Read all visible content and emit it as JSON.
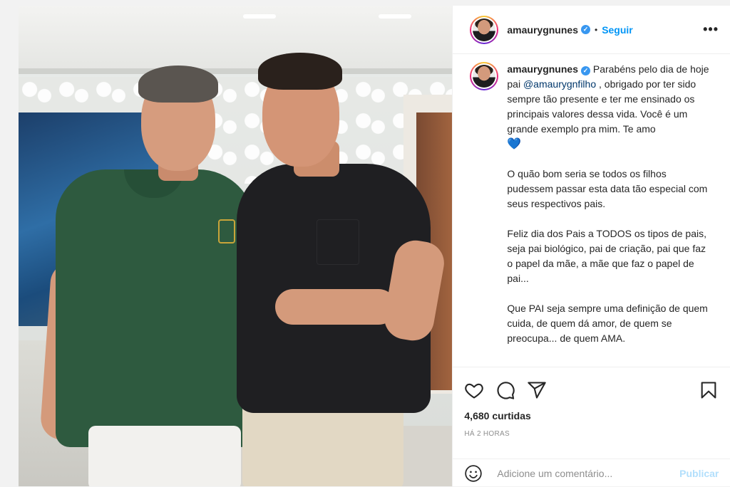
{
  "header": {
    "username": "amaurygnunes",
    "follow_label": "Seguir",
    "separator": "•",
    "more_label": "•••"
  },
  "caption": {
    "username": "amaurygnunes",
    "intro": " Parabéns pelo dia de hoje pai ",
    "mention": "@amaurygnfilho",
    "rest": " , obrigado por ter sido sempre tão presente e ter me ensinado os principais valores dessa vida. Você é um grande exemplo pra mim. Te amo",
    "heart": "💙",
    "paragraphs": [
      "O quão bom seria se todos os filhos pudessem passar esta data tão especial com seus respectivos pais.",
      "Feliz dia dos Pais a TODOS os tipos de pais, seja pai biológico, pai de criação, pai que faz o papel da mãe, a mãe que faz o papel de pai...",
      "Que PAI seja sempre uma definição de quem cuida, de quem dá amor, de quem se preocupa... de quem AMA."
    ]
  },
  "actions": {
    "icons": [
      "heart-icon",
      "comment-icon",
      "share-icon",
      "bookmark-icon"
    ],
    "likes": "4,680 curtidas",
    "time": "HÁ 2 HORAS"
  },
  "comment": {
    "placeholder": "Adicione um comentário...",
    "publish_label": "Publicar"
  },
  "colors": {
    "accent": "#0095f6",
    "publish_disabled": "#b2dffc",
    "verified": "#3897f0",
    "mention": "#00376b"
  }
}
